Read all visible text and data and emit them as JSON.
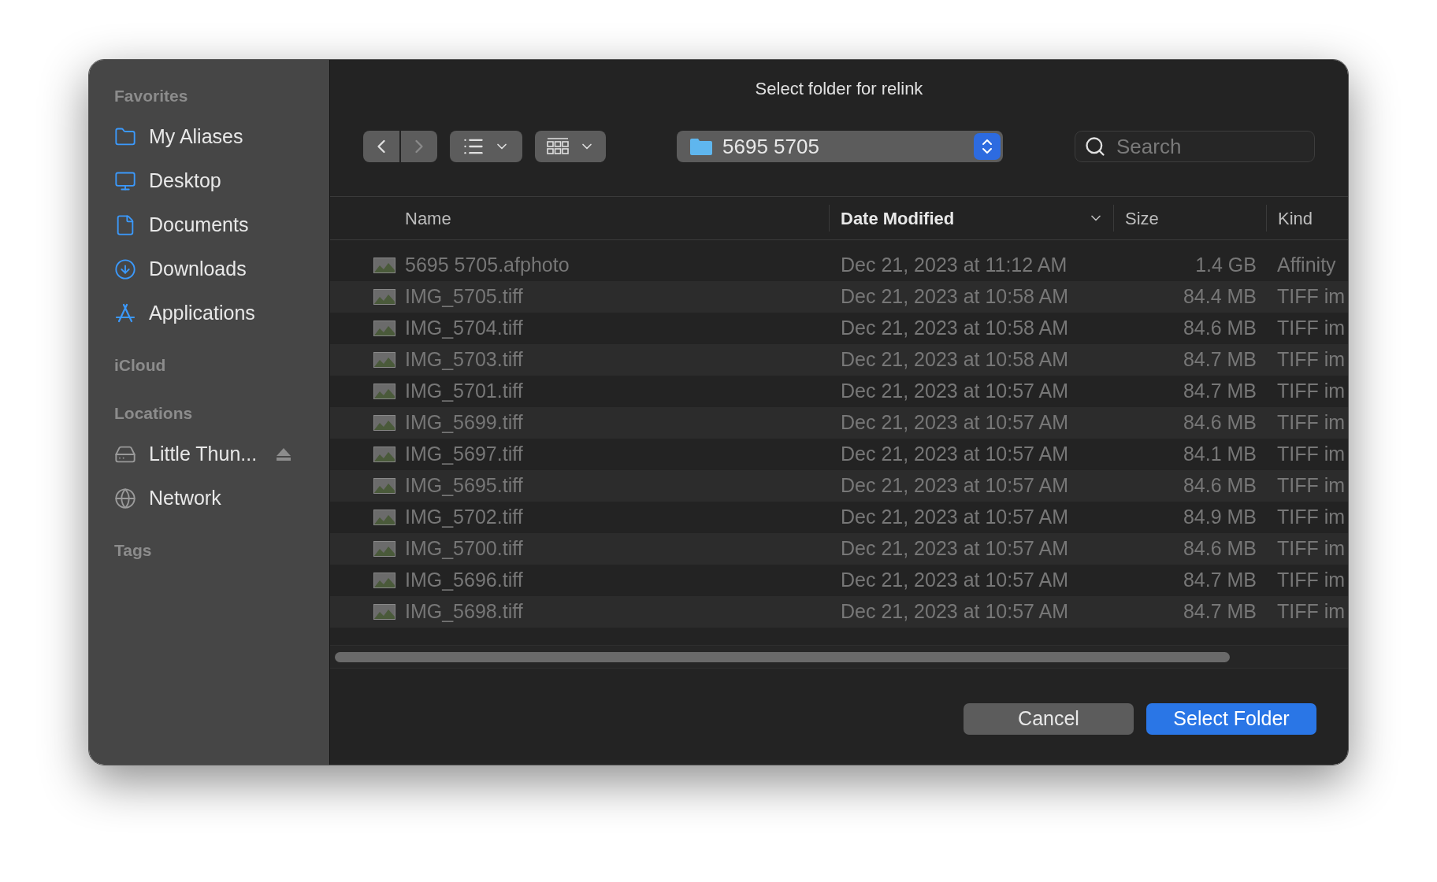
{
  "window": {
    "title": "Select folder for relink"
  },
  "sidebar": {
    "sections": [
      {
        "heading": "Favorites",
        "items": [
          {
            "label": "My Aliases",
            "kind": "folder"
          },
          {
            "label": "Desktop",
            "kind": "desktop"
          },
          {
            "label": "Documents",
            "kind": "document"
          },
          {
            "label": "Downloads",
            "kind": "download"
          },
          {
            "label": "Applications",
            "kind": "apps"
          }
        ]
      },
      {
        "heading": "iCloud"
      },
      {
        "heading": "Locations",
        "items": [
          {
            "label": "Little Thun...",
            "kind": "drive",
            "ejectable": true
          },
          {
            "label": "Network",
            "kind": "network"
          }
        ]
      },
      {
        "heading": "Tags"
      }
    ]
  },
  "toolbar": {
    "back_enabled": true,
    "forward_enabled": false,
    "location": "5695 5705",
    "search": {
      "placeholder": "Search"
    }
  },
  "table": {
    "columns": [
      {
        "label": "Name",
        "sorted": false
      },
      {
        "label": "Date Modified",
        "sorted": true
      },
      {
        "label": "Size",
        "sorted": false
      },
      {
        "label": "Kind",
        "sorted": false
      }
    ],
    "rows": [
      {
        "name": "5695 5705.afphoto",
        "date": "Dec 21, 2023 at 11:12 AM",
        "size": "1.4 GB",
        "kind": "Affinity",
        "disabled": true
      },
      {
        "name": "IMG_5705.tiff",
        "date": "Dec 21, 2023 at 10:58 AM",
        "size": "84.4 MB",
        "kind": "TIFF im",
        "disabled": true
      },
      {
        "name": "IMG_5704.tiff",
        "date": "Dec 21, 2023 at 10:58 AM",
        "size": "84.6 MB",
        "kind": "TIFF im",
        "disabled": true
      },
      {
        "name": "IMG_5703.tiff",
        "date": "Dec 21, 2023 at 10:58 AM",
        "size": "84.7 MB",
        "kind": "TIFF im",
        "disabled": true
      },
      {
        "name": "IMG_5701.tiff",
        "date": "Dec 21, 2023 at 10:57 AM",
        "size": "84.7 MB",
        "kind": "TIFF im",
        "disabled": true
      },
      {
        "name": "IMG_5699.tiff",
        "date": "Dec 21, 2023 at 10:57 AM",
        "size": "84.6 MB",
        "kind": "TIFF im",
        "disabled": true
      },
      {
        "name": "IMG_5697.tiff",
        "date": "Dec 21, 2023 at 10:57 AM",
        "size": "84.1 MB",
        "kind": "TIFF im",
        "disabled": true
      },
      {
        "name": "IMG_5695.tiff",
        "date": "Dec 21, 2023 at 10:57 AM",
        "size": "84.6 MB",
        "kind": "TIFF im",
        "disabled": true
      },
      {
        "name": "IMG_5702.tiff",
        "date": "Dec 21, 2023 at 10:57 AM",
        "size": "84.9 MB",
        "kind": "TIFF im",
        "disabled": true
      },
      {
        "name": "IMG_5700.tiff",
        "date": "Dec 21, 2023 at 10:57 AM",
        "size": "84.6 MB",
        "kind": "TIFF im",
        "disabled": true
      },
      {
        "name": "IMG_5696.tiff",
        "date": "Dec 21, 2023 at 10:57 AM",
        "size": "84.7 MB",
        "kind": "TIFF im",
        "disabled": true
      },
      {
        "name": "IMG_5698.tiff",
        "date": "Dec 21, 2023 at 10:57 AM",
        "size": "84.7 MB",
        "kind": "TIFF im",
        "disabled": true
      }
    ]
  },
  "buttons": [
    {
      "label": "Cancel",
      "primary": false
    },
    {
      "label": "Select Folder",
      "primary": true
    }
  ]
}
